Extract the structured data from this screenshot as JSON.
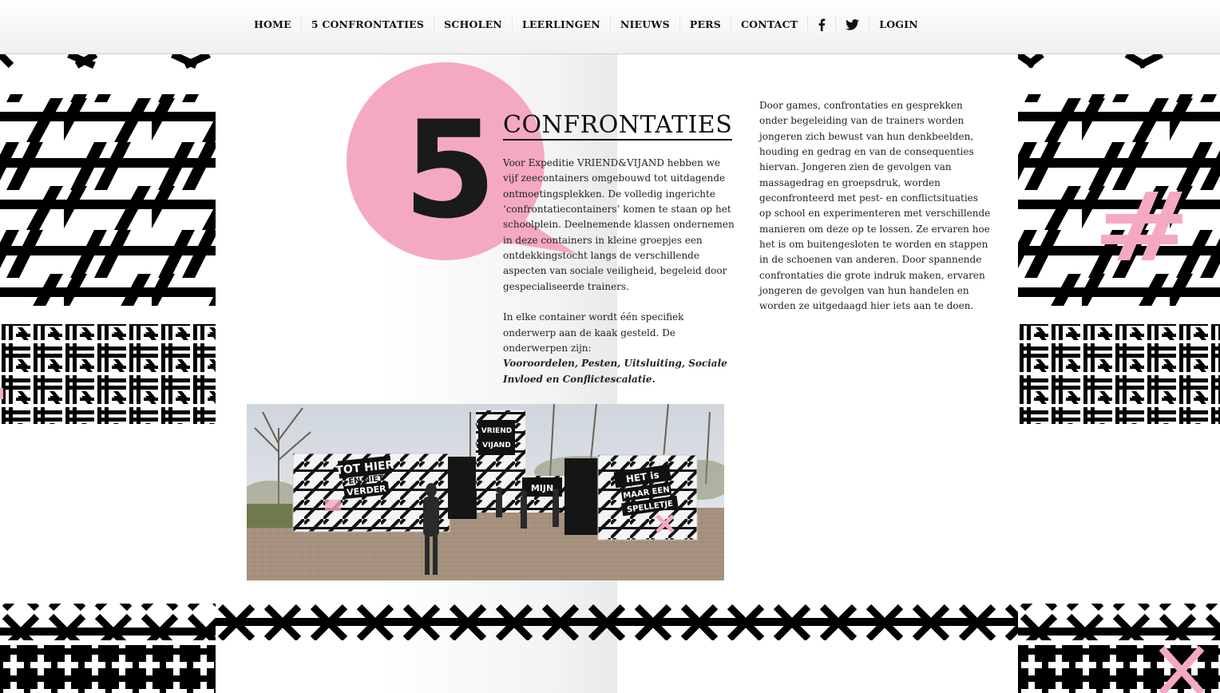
{
  "nav": {
    "items": [
      "HOME",
      "5 CONFRONTATIES",
      "SCHOLEN",
      "LEERLINGEN",
      "NIEUWS",
      "PERS",
      "CONTACT"
    ],
    "social_icons": [
      "facebook-icon",
      "twitter-icon"
    ],
    "login_label": "LOGIN"
  },
  "hero": {
    "number": "5",
    "title": "CONFRONTATIES"
  },
  "content": {
    "col1_p1": "Voor Expeditie VRIEND&VIJAND hebben we vijf zeecontainers omgebouwd tot uitdagende ontmoetingsplekken. De volledig ingerichte ‘confrontatiecontainers’ komen te staan op het schoolplein. Deelnemende klassen ondernemen in deze containers in kleine groepjes een ontdekkingstocht langs de verschillende aspecten van sociale veiligheid, begeleid door gespecialiseerde trainers.",
    "col1_p2": "In elke container wordt één specifiek onderwerp aan de kaak gesteld. De onderwerpen zijn:",
    "col1_topics": "Vooroordelen, Pesten, Uitsluiting, Sociale Invloed en Conflictescalatie.",
    "col2_p1": "Door games, confrontaties en gesprekken onder begeleiding van de trainers worden jongeren zich bewust van hun denkbeelden, houding en gedrag en van de consequenties hiervan. Jongeren zien de gevolgen van massagedrag en groepsdruk, worden geconfronteerd met pest- en conflictsituaties op school en experimenteren met verschillende manieren om deze op te lossen. Ze ervaren hoe het is om buitengesloten te worden en stappen in de schoenen van anderen. Door spannende confrontaties die grote indruk maken, ervaren jongeren de gevolgen van hun handelen en worden ze uitgedaagd hier iets aan te doen."
  },
  "photo": {
    "sign_left": [
      "TOT HIER",
      "EN NIET",
      "VERDER"
    ],
    "sign_right": [
      "HET is",
      "MAAR EEN",
      "SPELLETJE"
    ],
    "sign_tower": [
      "VRIEND",
      "VIJAND"
    ],
    "sign_middle": [
      "MIJN"
    ]
  },
  "colors": {
    "accent_pink": "#f5a9c1",
    "pattern_black": "#000000",
    "text": "#1a1a1a"
  }
}
